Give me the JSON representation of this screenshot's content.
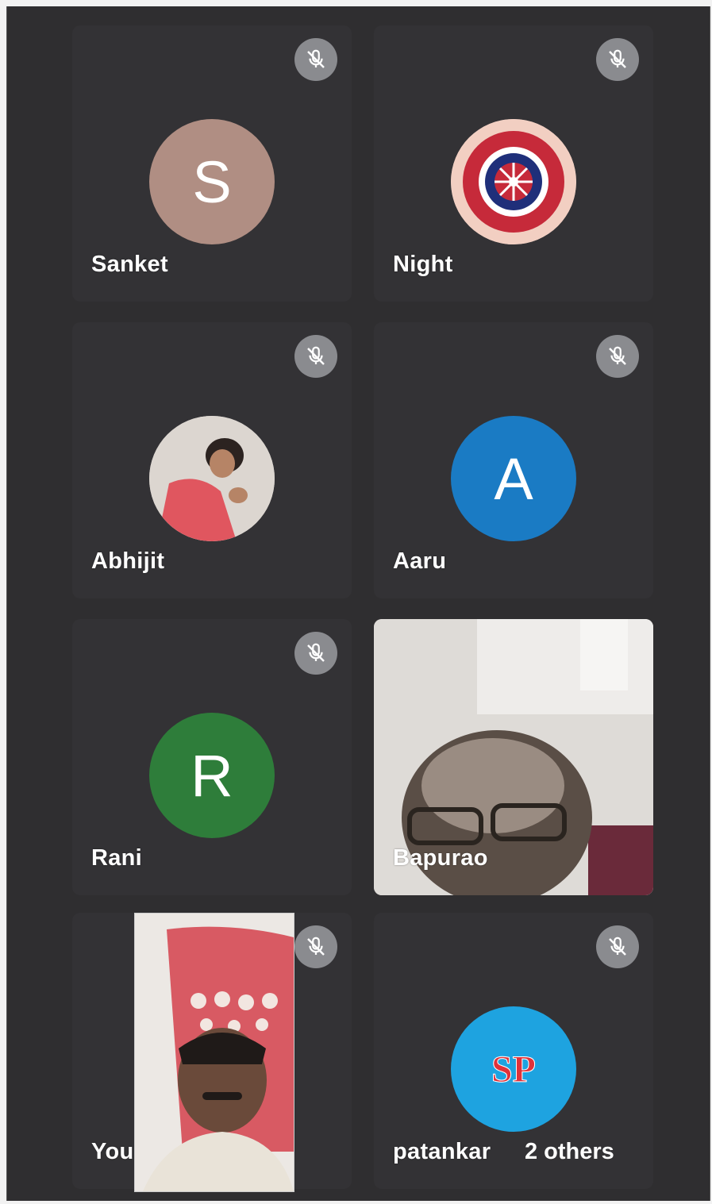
{
  "participants": [
    {
      "name": "Sanket",
      "initial": "S",
      "avatar_color": "#b08e83",
      "muted": true
    },
    {
      "name": "Night",
      "initial": "",
      "avatar_color": "#c2414b",
      "muted": true
    },
    {
      "name": "Abhijit",
      "initial": "",
      "avatar_color": "#d9d4cf",
      "muted": true
    },
    {
      "name": "Aaru",
      "initial": "A",
      "avatar_color": "#1a7bc4",
      "muted": true
    },
    {
      "name": "Rani",
      "initial": "R",
      "avatar_color": "#2e7d3a",
      "muted": true
    },
    {
      "name": "Bapurao",
      "muted": false,
      "video": true
    },
    {
      "name": "You",
      "muted": true,
      "video": true
    },
    {
      "name": "patankar",
      "initial": "SP",
      "avatar_color": "#1ea3e0",
      "muted": true,
      "extra": "2 others"
    }
  ],
  "icons": {
    "mute": "mic-off-icon"
  },
  "colors": {
    "screen_bg": "#2f2e30",
    "tile_bg": "#333235",
    "mute_bg": "#8a8b8f"
  }
}
